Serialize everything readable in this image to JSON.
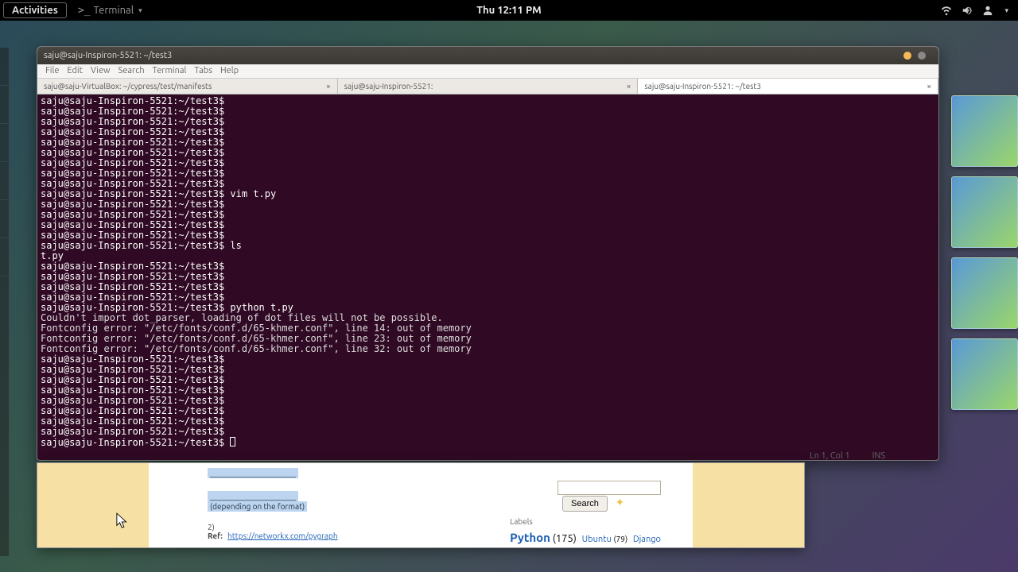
{
  "topbar": {
    "activities": "Activities",
    "app_icon_label": ">_",
    "app_name": "Terminal",
    "clock": "Thu 12:11 PM"
  },
  "terminal": {
    "title": "saju@saju-Inspiron-5521: ~/test3",
    "menu": [
      "File",
      "Edit",
      "View",
      "Search",
      "Terminal",
      "Tabs",
      "Help"
    ],
    "tabs": [
      {
        "label": "saju@saju-VirtualBox: ~/cypress/test/manifests"
      },
      {
        "label": "saju@saju-Inspiron-5521:"
      },
      {
        "label": "saju@saju-Inspiron-5521: ~/test3"
      }
    ],
    "prompt": "saju@saju-Inspiron-5521:~/test3$",
    "lines": [
      {
        "t": "p"
      },
      {
        "t": "p"
      },
      {
        "t": "p"
      },
      {
        "t": "p"
      },
      {
        "t": "p"
      },
      {
        "t": "p"
      },
      {
        "t": "p"
      },
      {
        "t": "p"
      },
      {
        "t": "p"
      },
      {
        "t": "c",
        "v": "vim t.py"
      },
      {
        "t": "p"
      },
      {
        "t": "p"
      },
      {
        "t": "p"
      },
      {
        "t": "p"
      },
      {
        "t": "c",
        "v": "ls"
      },
      {
        "t": "o",
        "v": "t.py"
      },
      {
        "t": "p"
      },
      {
        "t": "p"
      },
      {
        "t": "p"
      },
      {
        "t": "p"
      },
      {
        "t": "c",
        "v": "python t.py"
      },
      {
        "t": "e",
        "v": "Couldn't import dot_parser, loading of dot files will not be possible."
      },
      {
        "t": "e",
        "v": "Fontconfig error: \"/etc/fonts/conf.d/65-khmer.conf\", line 14: out of memory"
      },
      {
        "t": "e",
        "v": "Fontconfig error: \"/etc/fonts/conf.d/65-khmer.conf\", line 23: out of memory"
      },
      {
        "t": "e",
        "v": "Fontconfig error: \"/etc/fonts/conf.d/65-khmer.conf\", line 32: out of memory"
      },
      {
        "t": "o",
        "v": ""
      },
      {
        "t": "p"
      },
      {
        "t": "p"
      },
      {
        "t": "p"
      },
      {
        "t": "p"
      },
      {
        "t": "p"
      },
      {
        "t": "p"
      },
      {
        "t": "p"
      },
      {
        "t": "p"
      },
      {
        "t": "cur"
      }
    ]
  },
  "status": {
    "pos": "Ln 1, Col 1",
    "mode": "INS"
  },
  "browser": {
    "snippet_line1": "____________",
    "sel1": "______________________",
    "sel2": "(depending on the format)",
    "step_num": "2)",
    "ref_label": "Ref:",
    "ref_url": "https://networkx.com/pygraph",
    "search_btn": "Search",
    "labels_title": "Labels",
    "tag1": "Python",
    "tag1c": "(175)",
    "tag2": "Ubuntu",
    "tag2c": "(79)",
    "tag3": "Django"
  }
}
